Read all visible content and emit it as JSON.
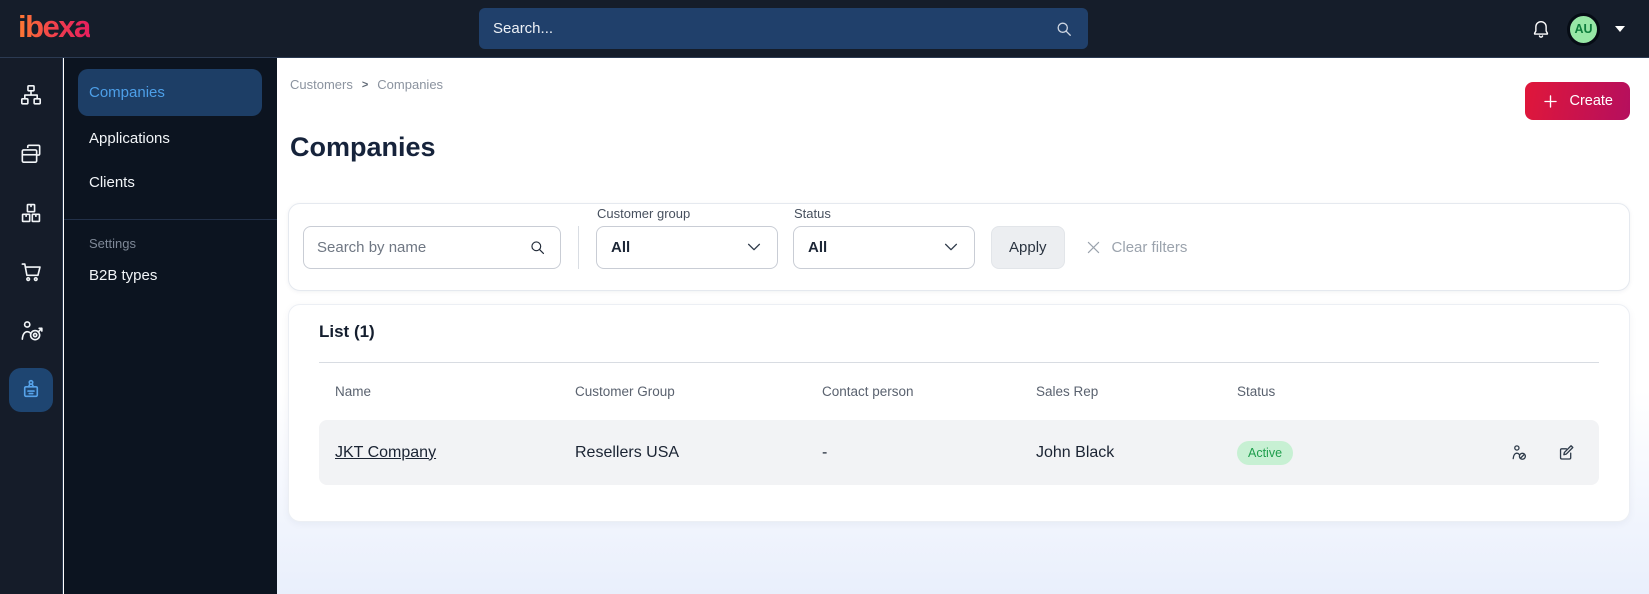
{
  "topbar": {
    "logo_text": "ibexa",
    "search_placeholder": "Search...",
    "user_initials": "AU"
  },
  "sidebar": {
    "rail_icons": [
      "content-tree-icon",
      "pages-icon",
      "products-icon",
      "cart-icon",
      "audience-icon",
      "company-badge-icon"
    ],
    "active_rail_icon": "company-badge-icon",
    "menu_items": [
      {
        "label": "Companies",
        "active": true
      },
      {
        "label": "Applications",
        "active": false
      },
      {
        "label": "Clients",
        "active": false
      }
    ],
    "section_label": "Settings",
    "section_items": [
      {
        "label": "B2B types"
      }
    ]
  },
  "breadcrumb": {
    "items": [
      "Customers",
      "Companies"
    ],
    "separator": ">"
  },
  "page": {
    "title": "Companies",
    "create_label": "Create"
  },
  "filters": {
    "name_search_placeholder": "Search by name",
    "customer_group_label": "Customer group",
    "customer_group_value": "All",
    "status_label": "Status",
    "status_value": "All",
    "apply_label": "Apply",
    "clear_label": "Clear filters"
  },
  "list": {
    "title": "List (1)",
    "columns": [
      "Name",
      "Customer Group",
      "Contact person",
      "Sales Rep",
      "Status"
    ],
    "rows": [
      {
        "name": "JKT Company",
        "customer_group": "Resellers USA",
        "contact_person": "-",
        "sales_rep": "John Black",
        "status": "Active"
      }
    ]
  },
  "colors": {
    "topbar_bg": "#151d2a",
    "sidebar_bg": "#0c1420",
    "topbar_search_bg": "#20406b",
    "accent_blue": "#4d9fe8",
    "active_item_bg": "#1d3e66",
    "brand_gradient_start": "#e0173a",
    "brand_gradient_end": "#b50f5e",
    "status_active_bg": "#c7f0d3",
    "status_active_text": "#1f9e4d",
    "avatar_bg": "#97e7a6",
    "avatar_text": "#0e7d3c",
    "row_bg": "#f2f3f5"
  }
}
